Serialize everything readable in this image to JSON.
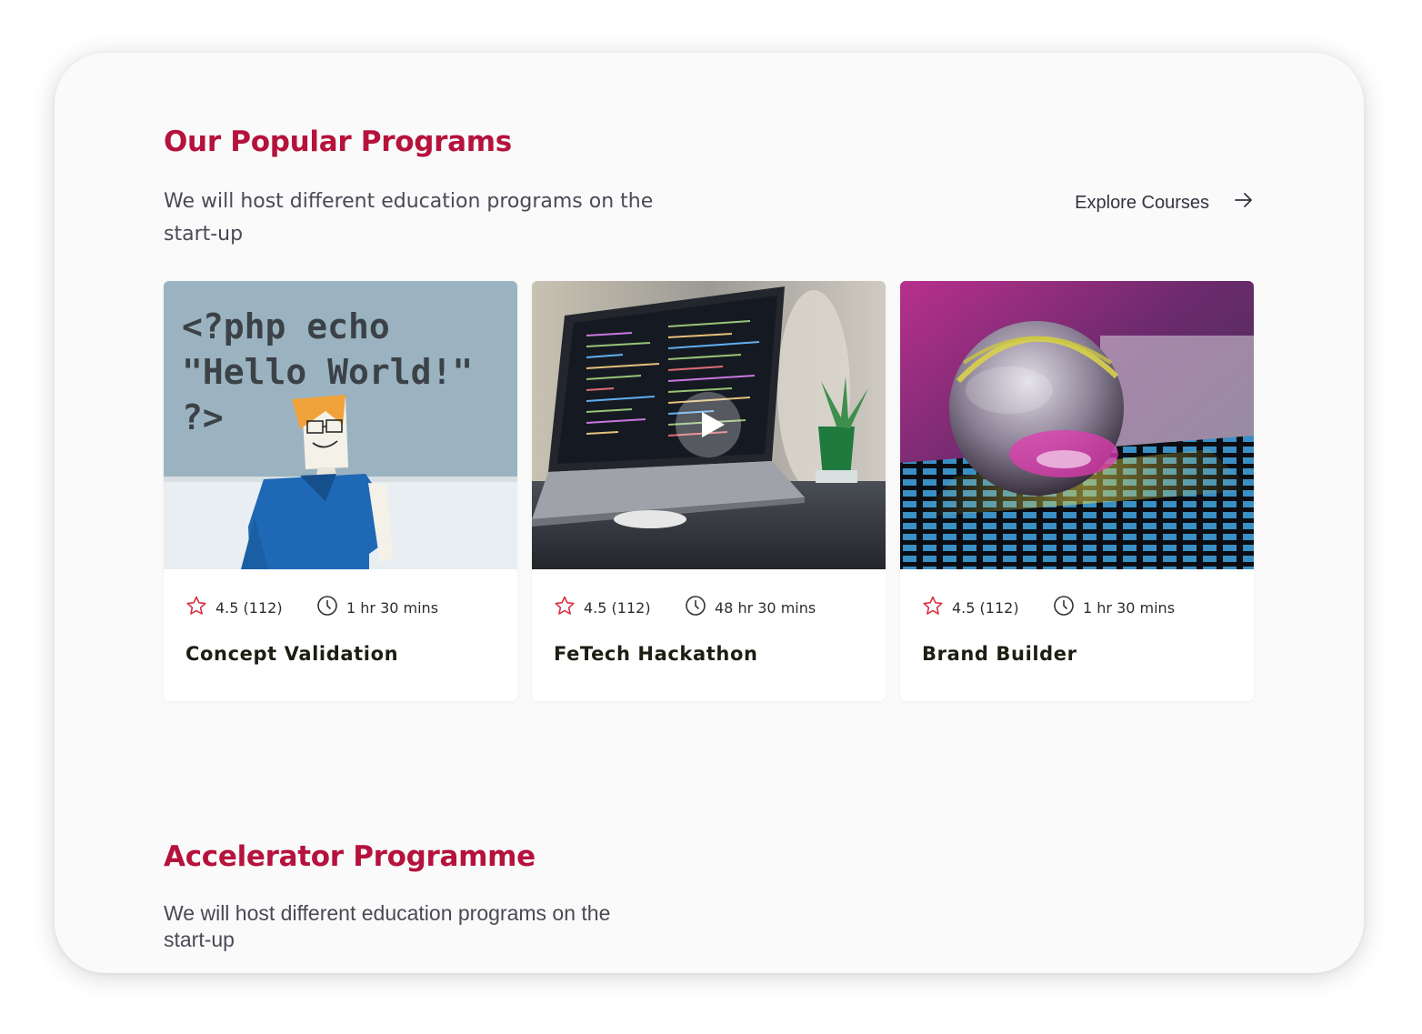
{
  "popular": {
    "title": "Our Popular Programs",
    "subtitle": "We will host different education programs on the start-up",
    "explore_label": "Explore Courses",
    "cards": [
      {
        "image_icon": "php-code-origami-image",
        "rating": "4.5 (112)",
        "duration": "1 hr 30 mins",
        "title": "Concept Validation"
      },
      {
        "image_icon": "laptop-code-image",
        "rating": "4.5 (112)",
        "duration": "48 hr 30 mins",
        "title": "FeTech Hackathon",
        "has_video": true
      },
      {
        "image_icon": "glass-sphere-image",
        "rating": "4.5 (112)",
        "duration": "1 hr 30 mins",
        "title": "Brand Builder"
      }
    ]
  },
  "accelerator": {
    "title": "Accelerator Programme",
    "subtitle": "We will host different education programs on the start-up"
  },
  "colors": {
    "accent": "#b5123c",
    "text": "#4a4a55",
    "star": "#d8263a"
  }
}
